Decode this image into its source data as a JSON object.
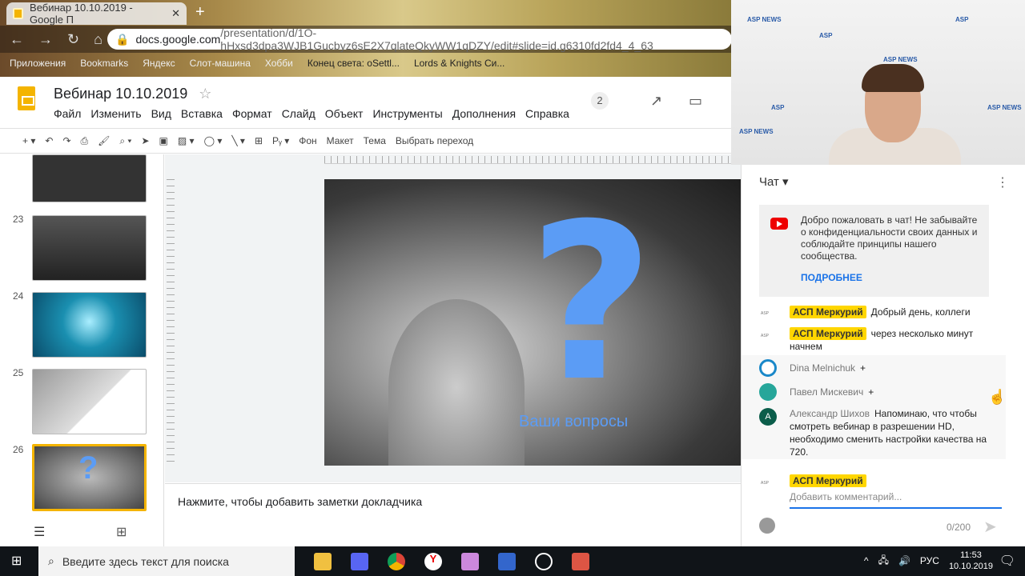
{
  "browser": {
    "tab_title": "Вебинар 10.10.2019 - Google П",
    "url_domain": "docs.google.com",
    "url_path": "/presentation/d/1O-hHxsd3dpa3WJB1Gucbyz6sE2X7qlateQkyWW1qDZY/edit#slide=id.g6310fd2fd4_4_63",
    "bookmarks": [
      "Приложения",
      "Bookmarks",
      "Яндекс",
      "Слот-машина",
      "Хобби",
      "Конец света: oSettl...",
      "Lords & Knights Си..."
    ]
  },
  "doc": {
    "title": "Вебинар 10.10.2019",
    "collaborators": "2",
    "menus": [
      "Файл",
      "Изменить",
      "Вид",
      "Вставка",
      "Формат",
      "Слайд",
      "Объект",
      "Инструменты",
      "Дополнения",
      "Справка"
    ],
    "toolbar": {
      "background": "Фон",
      "layout": "Макет",
      "theme": "Тема",
      "transition": "Выбрать переход"
    }
  },
  "slides": [
    {
      "num": "23"
    },
    {
      "num": "24"
    },
    {
      "num": "25"
    },
    {
      "num": "26"
    }
  ],
  "slide": {
    "caption": "Ваши вопросы",
    "accent": "#5b9cf5"
  },
  "notes_placeholder": "Нажмите, чтобы добавить заметки докладчика",
  "chat": {
    "title": "Чат",
    "welcome": "Добро пожаловать в чат! Не забывайте о конфиденциальности своих данных и соблюдайте принципы нашего сообщества.",
    "more": "ПОДРОБНЕЕ",
    "messages": [
      {
        "author": "АСП Меркурий",
        "text": "Добрый день, коллеги"
      },
      {
        "author": "АСП Меркурий",
        "text": "через несколько минут начнем"
      },
      {
        "author": "Dina Melnichuk",
        "text": "+"
      },
      {
        "author": "Павел Мискевич",
        "text": "+"
      },
      {
        "author": "Александр Шихов",
        "text": "Напоминаю, что чтобы смотреть вебинар в разрешении HD, необходимо сменить настройки качества на 720."
      }
    ],
    "current_user": "АСП Меркурий",
    "input_placeholder": "Добавить комментарий...",
    "counter": "0/200"
  },
  "taskbar": {
    "search_placeholder": "Введите здесь текст для поиска",
    "lang": "РУС",
    "time": "11:53",
    "date": "10.10.2019"
  }
}
